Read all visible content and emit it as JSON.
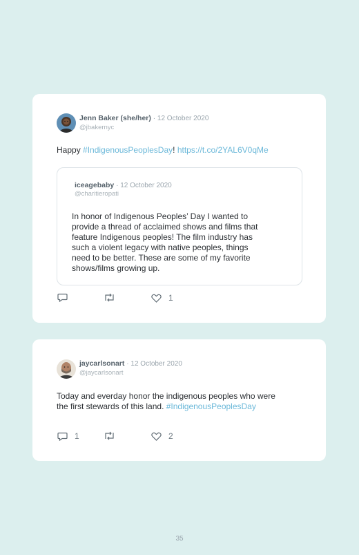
{
  "tweets": [
    {
      "author": "Jenn Baker (she/her)",
      "date": "· 12 October 2020",
      "handle": "@jbakernyc",
      "text_prefix": "Happy ",
      "hashtag": "#IndigenousPeoplesDay",
      "text_mid": "! ",
      "link": "https://t.co/2YAL6V0qMe",
      "quote": {
        "author": "iceagebaby",
        "date": "· 12 October 2020",
        "handle": "@charitieropati",
        "lines": [
          "In honor of Indigenous Peoples’ Day I wanted to",
          "provide a thread of acclaimed shows and films that",
          "feature Indigenous peoples! The film industry has",
          "such a violent legacy with native peoples, things",
          "need to be better. These are some of my favorite",
          "shows/films growing up."
        ]
      },
      "reply_count": "",
      "like_count": "1"
    },
    {
      "author": "jaycarlsonart",
      "date": "· 12 October 2020",
      "handle": "@jaycarlsonart",
      "line1": "Today and everday honor the indigenous peoples who were",
      "line2_prefix": "the first stewards of this land. ",
      "hashtag": "#IndigenousPeoplesDay",
      "reply_count": "1",
      "like_count": "2"
    }
  ],
  "page_number": "35",
  "colors": {
    "background": "#dcefee",
    "card": "#ffffff",
    "link": "#6bb8d9"
  },
  "icons": [
    "reply-icon",
    "retweet-icon",
    "like-icon"
  ]
}
